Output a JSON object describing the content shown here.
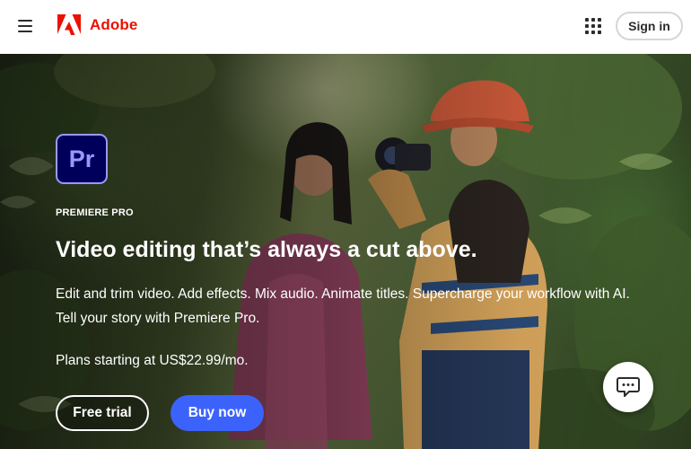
{
  "header": {
    "menu_icon": "hamburger-menu-icon",
    "brand_name": "Adobe",
    "brand_color": "#eb1000",
    "apps_icon": "app-grid-icon",
    "signin_label": "Sign in"
  },
  "hero": {
    "product_badge": "Pr",
    "product_badge_color": "#9999ff",
    "product_badge_bg": "#00005b",
    "eyebrow": "PREMIERE PRO",
    "headline": "Video editing that’s always a cut above.",
    "description": "Edit and trim video. Add effects. Mix audio. Animate titles. Supercharge your workflow with AI. Tell your story with Premiere Pro.",
    "price_text": "Plans starting at US$22.99/mo.",
    "primary_cta": "Free trial",
    "secondary_cta": "Buy now",
    "secondary_cta_color": "#3b63fb",
    "chat_icon": "chat-bubble-icon"
  }
}
